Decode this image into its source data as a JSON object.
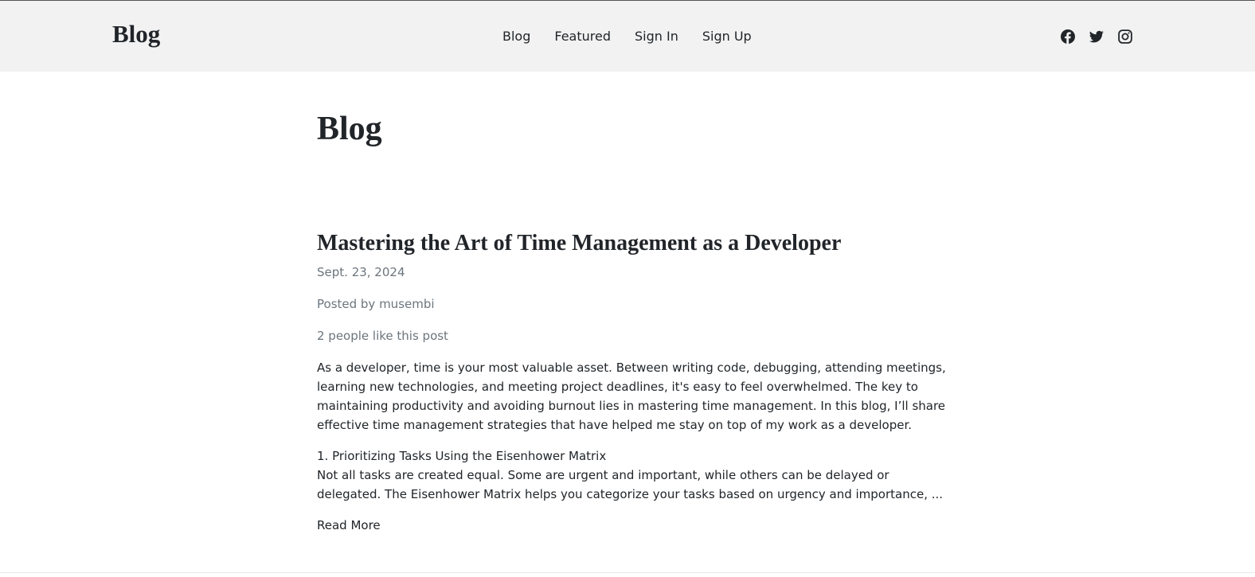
{
  "header": {
    "brand": "Blog",
    "nav": [
      {
        "label": "Blog"
      },
      {
        "label": "Featured"
      },
      {
        "label": "Sign In"
      },
      {
        "label": "Sign Up"
      }
    ],
    "social_icons": [
      "facebook-icon",
      "twitter-icon",
      "instagram-icon"
    ]
  },
  "main": {
    "page_title": "Blog",
    "post": {
      "title": "Mastering the Art of Time Management as a Developer",
      "date": "Sept. 23, 2024",
      "author_line": "Posted by musembi",
      "likes_line": "2 people like this post",
      "excerpt_p1": "As a developer, time is your most valuable asset. Between writing code, debugging, attending meetings, learning new technologies, and meeting project deadlines, it's easy to feel overwhelmed. The key to maintaining productivity and avoiding burnout lies in mastering time management. In this blog, I’ll share effective time management strategies that have helped me stay on top of my work as a developer.",
      "excerpt_heading": "1. Prioritizing Tasks Using the Eisenhower Matrix",
      "excerpt_p2": "Not all tasks are created equal. Some are urgent and important, while others can be delayed or delegated. The Eisenhower Matrix helps you categorize your tasks based on urgency and importance, ...",
      "read_more": "Read More"
    }
  },
  "colors": {
    "header_bg": "#f2f2f2",
    "text": "#212529",
    "muted": "#6c757d"
  }
}
